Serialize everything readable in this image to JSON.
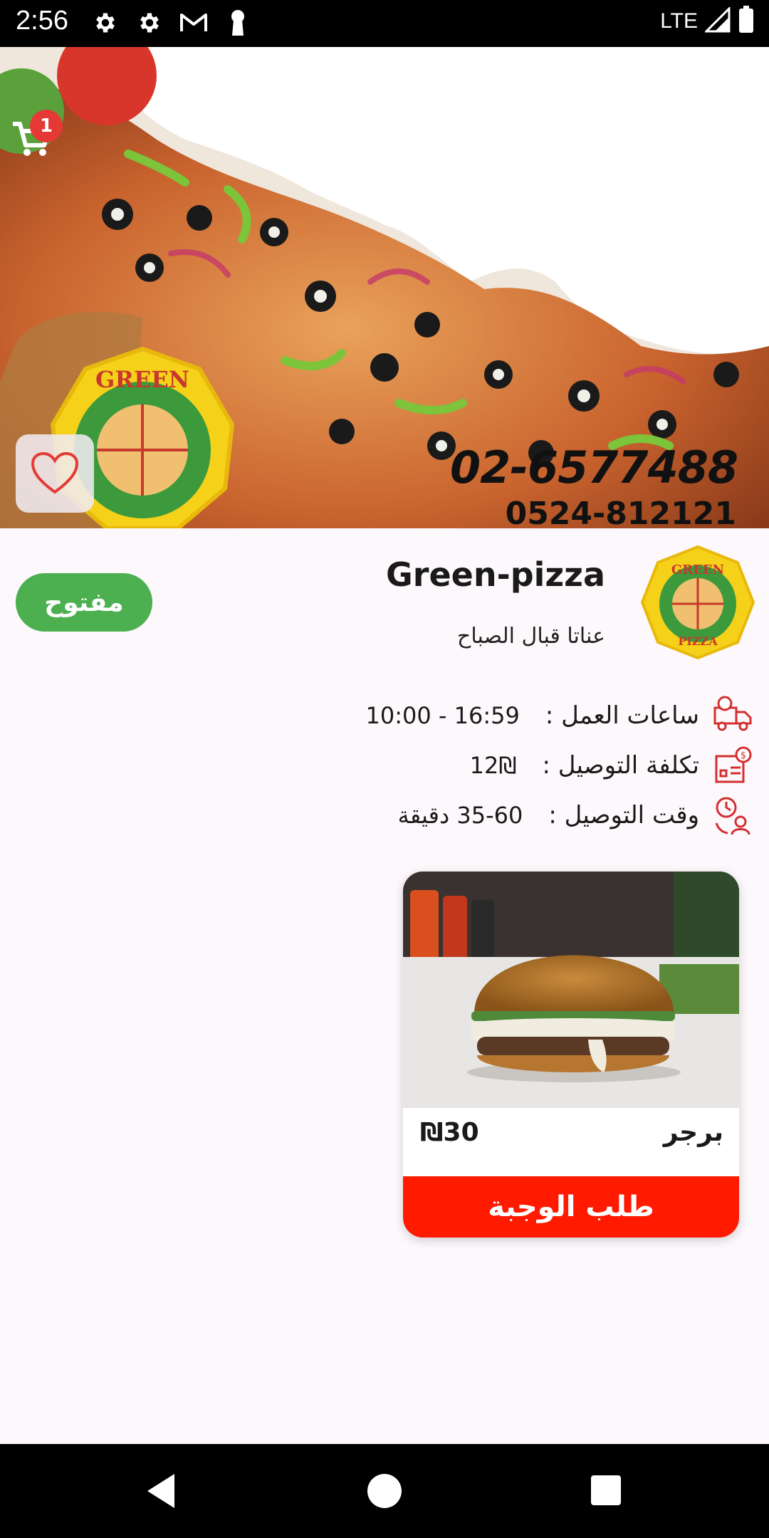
{
  "status_bar": {
    "time": "2:56",
    "network": "LTE",
    "icons": [
      "settings-icon",
      "settings-icon",
      "gmail-icon",
      "keyhole-icon",
      "signal-icon",
      "battery-icon"
    ]
  },
  "hero": {
    "cart_count": "1",
    "phone_1": "02-6577488",
    "phone_2": "0524-812121",
    "logo_text_top": "GREEN",
    "logo_text_bottom": "PIZZA"
  },
  "restaurant": {
    "status": "مفتوح",
    "name": "Green-pizza",
    "address": "عناتا قبال الصباح",
    "hours_label": "ساعات العمل :",
    "hours_value": "16:59 - 10:00",
    "delivery_cost_label": "تكلفة التوصيل :",
    "delivery_cost_value": "12₪",
    "delivery_time_label": "وقت التوصيل :",
    "delivery_time_value": "35-60 دقيقة"
  },
  "products": [
    {
      "name": "برجر",
      "price": "₪30",
      "order_label": "طلب الوجبة"
    }
  ],
  "colors": {
    "open_green": "#4caf50",
    "order_red": "#ff1a00",
    "badge_red": "#e53935",
    "icon_red": "#d32f2f"
  }
}
